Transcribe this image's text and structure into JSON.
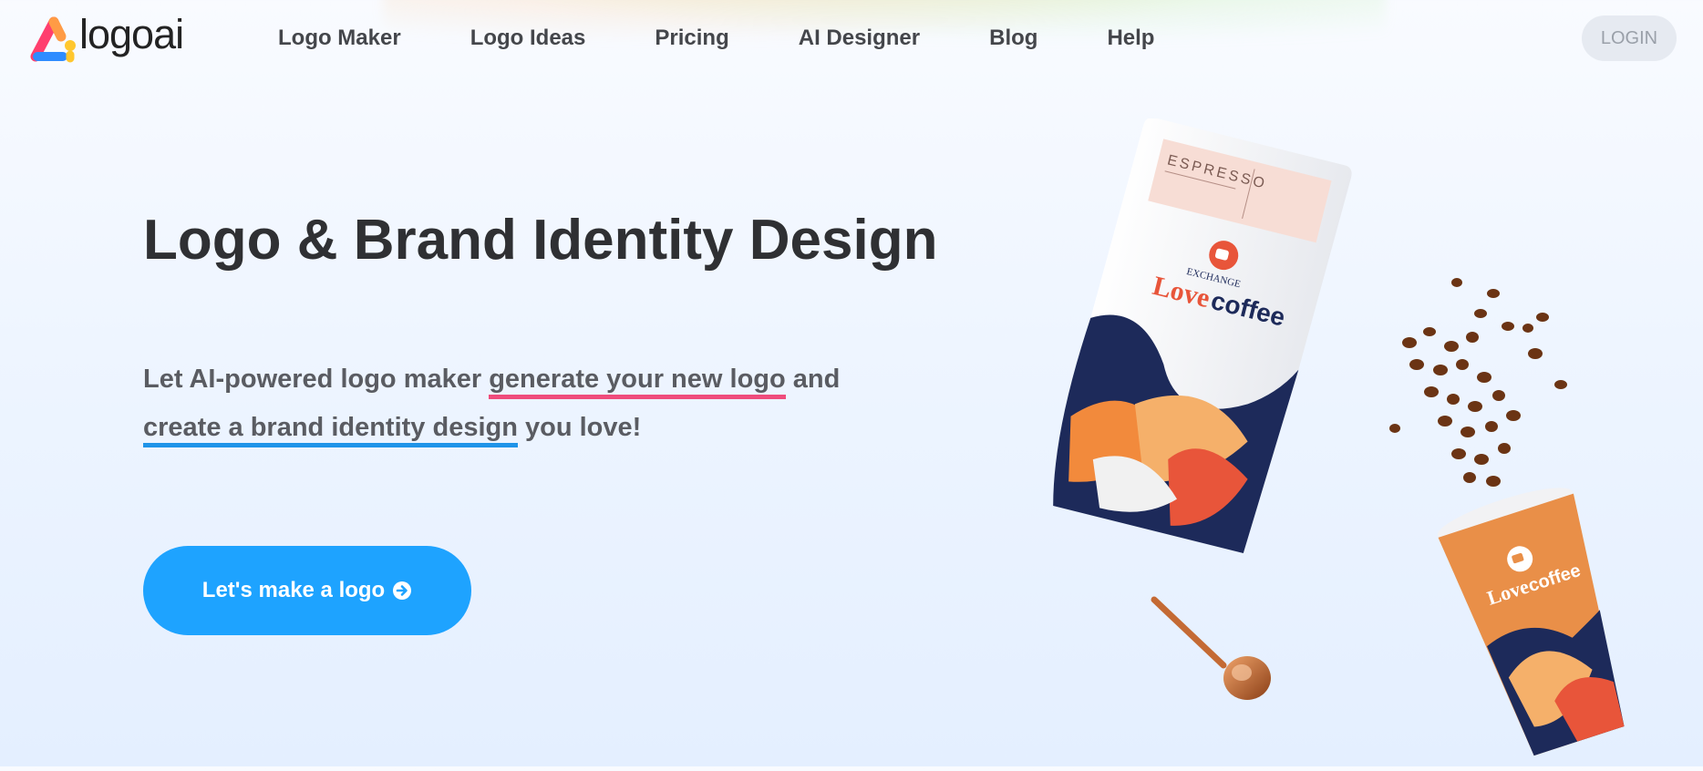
{
  "header": {
    "brand": "logoai",
    "nav": [
      {
        "label": "Logo Maker"
      },
      {
        "label": "Logo Ideas"
      },
      {
        "label": "Pricing"
      },
      {
        "label": "AI Designer"
      },
      {
        "label": "Blog"
      },
      {
        "label": "Help"
      }
    ],
    "login_label": "LOGIN"
  },
  "hero": {
    "title": "Logo & Brand Identity Design",
    "subtitle": {
      "part1": "Let AI-powered logo maker ",
      "highlight1": "generate your new logo",
      "part2": " and ",
      "highlight2": "create a brand identity design",
      "part3": " you love!"
    },
    "cta_label": "Let's make a logo",
    "cta_icon": "arrow-circle-right-icon"
  },
  "illustration": {
    "bag_label": "ESPRESSO",
    "bag_small": "EXCHANGE",
    "brand_love": "Love",
    "brand_coffee": "coffee"
  },
  "colors": {
    "accent": "#1ea3ff",
    "pink_underline": "#ef4c7c",
    "blue_underline": "#1f94e8",
    "brand_orange": "#e8553a",
    "brand_navy": "#1d2a5a"
  }
}
